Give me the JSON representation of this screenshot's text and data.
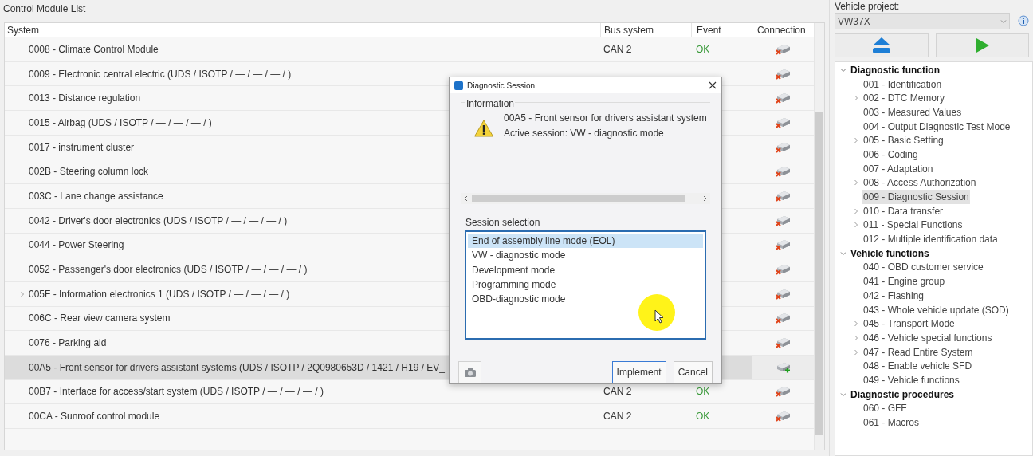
{
  "panel_title": "Control Module List",
  "table": {
    "columns": [
      "System",
      "Bus system",
      "Event",
      "Connection"
    ],
    "rows": [
      {
        "system": "0008 - Climate Control Module",
        "bus": "CAN 2",
        "event": "OK",
        "connected": false,
        "selected": false
      },
      {
        "system": "0009 - Electronic central electric  (UDS / ISOTP / — / — / — /  )",
        "connected": false,
        "selected": false
      },
      {
        "system": "0013 - Distance regulation",
        "connected": false,
        "selected": false
      },
      {
        "system": "0015 - Airbag  (UDS / ISOTP / — / — / — /  )",
        "connected": false,
        "selected": false
      },
      {
        "system": "0017 - instrument cluster",
        "connected": false,
        "selected": false
      },
      {
        "system": "002B - Steering column lock",
        "connected": false,
        "selected": false
      },
      {
        "system": "003C - Lane change assistance",
        "connected": false,
        "selected": false
      },
      {
        "system": "0042 - Driver's door electronics  (UDS / ISOTP / — / — / — /  )",
        "connected": false,
        "selected": false
      },
      {
        "system": "0044 - Power Steering",
        "connected": false,
        "selected": false
      },
      {
        "system": "0052 - Passenger's door electronics  (UDS / ISOTP / — / — / — /  )",
        "connected": false,
        "selected": false
      },
      {
        "system": "005F - Information electronics 1  (UDS / ISOTP / — / — / — /  )",
        "connected": false,
        "selected": false,
        "expanded": false
      },
      {
        "system": "006C - Rear view camera system",
        "connected": false,
        "selected": false
      },
      {
        "system": "0076 - Parking aid",
        "connected": false,
        "selected": false
      },
      {
        "system": "00A5 - Front sensor for drivers assistant systems  (UDS / ISOTP / 2Q0980653D / 1421 / H19 / EV_",
        "connected": true,
        "selected": true
      },
      {
        "system": "00B7 - Interface for access/start system  (UDS / ISOTP / — / — / — /  )",
        "bus": "CAN 2",
        "event": "OK",
        "connected": false,
        "selected": false
      },
      {
        "system": "00CA - Sunroof control module",
        "bus": "CAN 2",
        "event": "OK",
        "connected": false,
        "selected": false
      }
    ]
  },
  "vehicle_project": {
    "label": "Vehicle project:",
    "value": "VW37X"
  },
  "tree": [
    {
      "label": "Diagnostic function",
      "expanded": true,
      "children": [
        {
          "label": "001 - Identification",
          "selected": false
        },
        {
          "label": "002 - DTC Memory",
          "selected": false,
          "expanded": false
        },
        {
          "label": "003 - Measured Values",
          "selected": false
        },
        {
          "label": "004 - Output Diagnostic Test Mode",
          "selected": false
        },
        {
          "label": "005 - Basic Setting",
          "selected": false,
          "expanded": false
        },
        {
          "label": "006 - Coding",
          "selected": false
        },
        {
          "label": "007 - Adaptation",
          "selected": false
        },
        {
          "label": "008 - Access Authorization",
          "selected": false,
          "expanded": false
        },
        {
          "label": "009 - Diagnostic Session",
          "selected": true
        },
        {
          "label": "010 - Data transfer",
          "selected": false,
          "expanded": false
        },
        {
          "label": "011 - Special Functions",
          "selected": false,
          "expanded": false
        },
        {
          "label": "012 - Multiple identification data",
          "selected": false
        }
      ]
    },
    {
      "label": "Vehicle functions",
      "expanded": true,
      "children": [
        {
          "label": "040 - OBD customer service",
          "selected": false
        },
        {
          "label": "041 - Engine group",
          "selected": false
        },
        {
          "label": "042 - Flashing",
          "selected": false
        },
        {
          "label": "043 - Whole vehicle update (SOD)",
          "selected": false
        },
        {
          "label": "045 - Transport Mode",
          "selected": false,
          "expanded": false
        },
        {
          "label": "046 - Vehicle special functions",
          "selected": false,
          "expanded": false
        },
        {
          "label": "047 - Read Entire System",
          "selected": false,
          "expanded": false
        },
        {
          "label": "048 - Enable vehicle SFD",
          "selected": false
        },
        {
          "label": "049 - Vehicle functions",
          "selected": false
        }
      ]
    },
    {
      "label": "Diagnostic procedures",
      "expanded": true,
      "children": [
        {
          "label": "060 - GFF",
          "selected": false
        },
        {
          "label": "061 - Macros",
          "selected": false
        }
      ]
    }
  ],
  "dialog": {
    "title": "Diagnostic Session",
    "information": {
      "label": "Information",
      "lines": [
        "00A5 - Front sensor for drivers assistant system",
        "Active session: VW - diagnostic mode"
      ]
    },
    "session_selection": {
      "label": "Session selection",
      "options": [
        {
          "label": "End of assembly line mode (EOL)",
          "selected": true
        },
        {
          "label": "VW - diagnostic mode",
          "selected": false
        },
        {
          "label": "Development mode",
          "selected": false
        },
        {
          "label": "Programming mode",
          "selected": false
        },
        {
          "label": "OBD-diagnostic mode",
          "selected": false
        }
      ]
    },
    "buttons": [
      "Implement",
      "Cancel"
    ]
  }
}
